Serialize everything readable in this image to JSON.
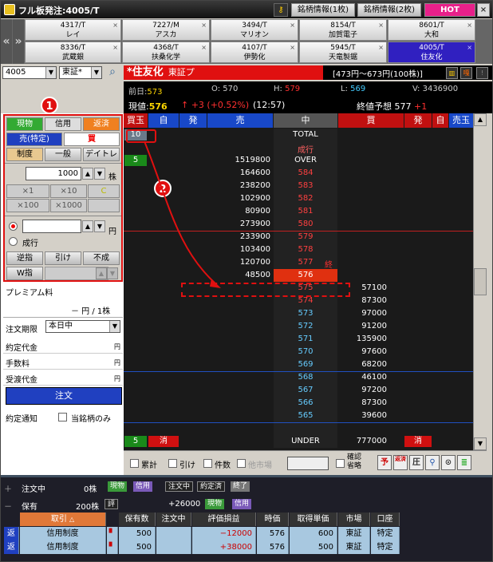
{
  "window": {
    "title": "フル板発注:4005/T",
    "btn_info1": "銘柄情報(1枚)",
    "btn_info2": "銘柄情報(2枚)",
    "btn_hot": "HOT",
    "btn_close": "×"
  },
  "tickers": [
    {
      "code": "4317/T",
      "name": "レイ"
    },
    {
      "code": "7227/M",
      "name": "アスカ"
    },
    {
      "code": "3494/T",
      "name": "マリオン"
    },
    {
      "code": "8154/T",
      "name": "加賀電子"
    },
    {
      "code": "8601/T",
      "name": "大和"
    },
    {
      "code": "8336/T",
      "name": "武蔵銀"
    },
    {
      "code": "4368/T",
      "name": "扶桑化学"
    },
    {
      "code": "4107/T",
      "name": "伊勢化"
    },
    {
      "code": "5945/T",
      "name": "天竜製鋸"
    },
    {
      "code": "4005/T",
      "name": "住友化"
    }
  ],
  "toolbar": {
    "code_value": "4005",
    "market_value": "東証*",
    "stock_name": "*住友化",
    "exchange": "東証プ",
    "price_range": "[473円〜673円(100株)]"
  },
  "info": {
    "prev_label": "前日:",
    "prev": "573",
    "open_label": "O:",
    "open": "570",
    "high_label": "H:",
    "high": "579",
    "low_label": "L:",
    "low": "569",
    "vol_label": "V:",
    "vol": "3436900",
    "cur_label": "現値:",
    "cur": "576",
    "change": "↑ +3 (+0.52%)",
    "time": "(12:57)",
    "forecast_label": "終値予想",
    "forecast": "577",
    "forecast_change": "+1"
  },
  "order": {
    "tab_cash": "現物",
    "tab_margin": "信用",
    "tab_repay": "返済",
    "sell": "売(特定)",
    "buy": "買",
    "type_seido": "制度",
    "type_ippan": "一般",
    "type_day": "デイトレ",
    "qty": "1000",
    "qty_unit": "株",
    "x1": "×1",
    "x10": "×10",
    "clear": "C",
    "x100": "×100",
    "x1000": "×1000",
    "price_value": "",
    "price_unit": "円",
    "market_order": "成行",
    "gyakusashi": "逆指",
    "hike": "引け",
    "funari": "不成",
    "wsashi": "W指"
  },
  "premium": {
    "label": "プレミアム料",
    "value": "－ 円 / 1株"
  },
  "period": {
    "label": "注文期限",
    "value": "本日中"
  },
  "fees": [
    {
      "label": "約定代金",
      "unit": "円"
    },
    {
      "label": "手数料",
      "unit": "円"
    },
    {
      "label": "受渡代金",
      "unit": "円"
    }
  ],
  "order_btn": "注文",
  "notify": {
    "label": "約定通知",
    "this_only": "当銘柄のみ"
  },
  "board": {
    "headers": [
      "買玉",
      "自",
      "発",
      "売",
      "中",
      "買",
      "発",
      "自",
      "売玉"
    ],
    "rows": [
      {
        "kaidama": "10",
        "sell": "",
        "price": "TOTAL",
        "buy": ""
      },
      {
        "kaidama": "",
        "sell": "",
        "price": "成行",
        "buy": ""
      },
      {
        "kaidama": "5",
        "sell": "1519800",
        "price": "OVER",
        "buy": ""
      },
      {
        "sell": "164600",
        "price": "584",
        "buy": ""
      },
      {
        "sell": "238200",
        "price": "583",
        "buy": ""
      },
      {
        "sell": "102900",
        "price": "582",
        "buy": ""
      },
      {
        "sell": "80900",
        "price": "581",
        "buy": ""
      },
      {
        "sell": "273900",
        "price": "580",
        "buy": ""
      },
      {
        "sell": "233900",
        "price": "579",
        "buy": ""
      },
      {
        "sell": "103400",
        "price": "578",
        "buy": ""
      },
      {
        "sell": "120700",
        "price": "577",
        "buy": "",
        "mark": "終"
      },
      {
        "sell": "48500",
        "price": "576",
        "buy": ""
      },
      {
        "sell": "",
        "price": "575",
        "buy": "57100"
      },
      {
        "sell": "",
        "price": "574",
        "buy": "87300"
      },
      {
        "sell": "",
        "price": "573",
        "buy": "97000"
      },
      {
        "sell": "",
        "price": "572",
        "buy": "91200"
      },
      {
        "sell": "",
        "price": "571",
        "buy": "135900"
      },
      {
        "sell": "",
        "price": "570",
        "buy": "97600"
      },
      {
        "sell": "",
        "price": "569",
        "buy": "68200"
      },
      {
        "sell": "",
        "price": "568",
        "buy": "46100"
      },
      {
        "sell": "",
        "price": "567",
        "buy": "97200"
      },
      {
        "sell": "",
        "price": "566",
        "buy": "87300"
      },
      {
        "sell": "",
        "price": "565",
        "buy": "39600"
      },
      {
        "sell": "",
        "price": "",
        "buy": ""
      },
      {
        "kaidama": "5",
        "cancel": "消",
        "price": "UNDER",
        "buy": "777000",
        "cancel2": "消"
      }
    ]
  },
  "footer": {
    "ruikei": "累計",
    "hike": "引け",
    "kensu": "件数",
    "other": "他市場",
    "confirm1": "確認",
    "confirm2": "省略",
    "icons": [
      "予",
      "返済",
      "圧",
      "押",
      "マウス",
      "株"
    ]
  },
  "bottom": {
    "pending_label": "注文中",
    "pending_qty": "0株",
    "tag_cash": "現物",
    "tag_margin": "信用",
    "tag_pending": "注文中",
    "tag_executed": "約定済",
    "tag_done": "終了",
    "hold_label": "保有",
    "hold_qty": "200株",
    "eval_tag": "評",
    "pnl_total": "+26000",
    "cols": [
      "取引",
      "保有数",
      "注文中",
      "評価損益",
      "時価",
      "取得単価",
      "市場",
      "口座"
    ],
    "rows": [
      {
        "ret": "返",
        "type": "信用制度",
        "qty": "500",
        "pending": "",
        "pnl": "−12000",
        "price": "576",
        "cost": "600",
        "market": "東証",
        "account": "特定"
      },
      {
        "ret": "返",
        "type": "信用制度",
        "qty": "500",
        "pending": "",
        "pnl": "+38000",
        "price": "576",
        "cost": "500",
        "market": "東証",
        "account": "特定"
      }
    ]
  },
  "annotations": [
    "1",
    "2"
  ]
}
